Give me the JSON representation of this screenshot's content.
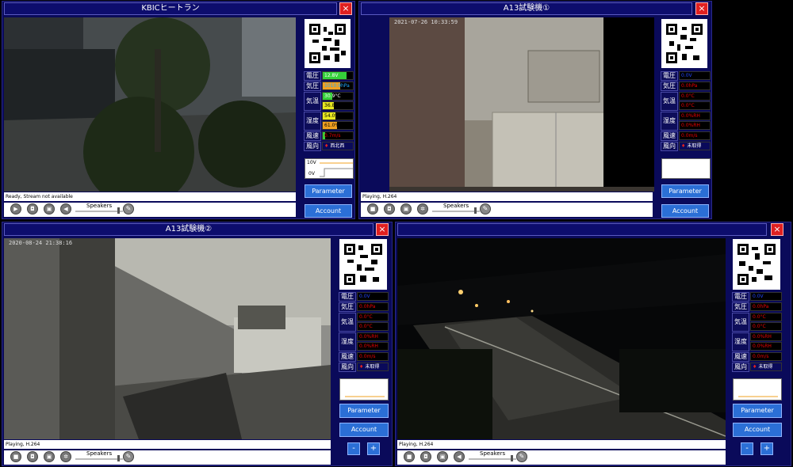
{
  "panels": [
    {
      "title": "KBICヒートラン",
      "timestamp": "",
      "status": "Ready, Stream not available",
      "readings": {
        "voltage": "12.8V",
        "pressure": "1010.9hPa",
        "temp1": "30.9°C",
        "temp2": "36.8°C",
        "hum1": "54.0%RH",
        "hum2": "61.0%RH",
        "wind": "0.7m/s",
        "winddir": "西北西"
      },
      "graph": {
        "top": "10V",
        "bottom": "0V"
      }
    },
    {
      "title": "A13試験機①",
      "timestamp": "2021-07-26  10:33:59",
      "status": "Playing, H.264",
      "readings": {
        "voltage": "0.0V",
        "pressure": "0.0hPa",
        "temp1": "0.0°C",
        "temp2": "0.0°C",
        "hum1": "0.0%RH",
        "hum2": "0.0%RH",
        "wind": "0.0m/s",
        "winddir": "未取得"
      }
    },
    {
      "title": "A13試験機②",
      "timestamp": "2020-08-24  21:38:16",
      "status": "Playing, H.264",
      "readings": {
        "voltage": "0.0V",
        "pressure": "0.0hPa",
        "temp1": "0.0°C",
        "temp2": "0.0°C",
        "hum1": "0.0%RH",
        "hum2": "0.0%RH",
        "wind": "0.0m/s",
        "winddir": "未取得"
      }
    },
    {
      "title": "",
      "timestamp": "",
      "status": "Playing, H.264",
      "readings": {
        "voltage": "0.0V",
        "pressure": "0.0hPa",
        "temp1": "0.0°C",
        "temp2": "0.0°C",
        "hum1": "0.0%RH",
        "hum2": "0.0%RH",
        "wind": "0.0m/s",
        "winddir": "未取得"
      }
    }
  ],
  "labels": {
    "voltage": "電圧",
    "pressure": "気圧",
    "temp": "気温",
    "humidity": "湿度",
    "wind": "風速",
    "winddir": "風向",
    "close": "×",
    "speakers": "Speakers",
    "parameter": "Parameter",
    "account": "Account",
    "minus": "-",
    "plus": "+"
  },
  "icons": [
    "play-icon",
    "camera-icon",
    "record-icon",
    "mute-icon",
    "pen-icon",
    "stop-icon",
    "gear-icon"
  ],
  "colors": {
    "window_bg": "#0a0a5a",
    "close": "#e02020",
    "button": "#2b6fd6",
    "value_text": "#e00000",
    "bar_green": "#35d03a",
    "bar_orange": "#f0a020",
    "bar_yellow": "#e8e820",
    "wind_arrow": "#e02020"
  }
}
